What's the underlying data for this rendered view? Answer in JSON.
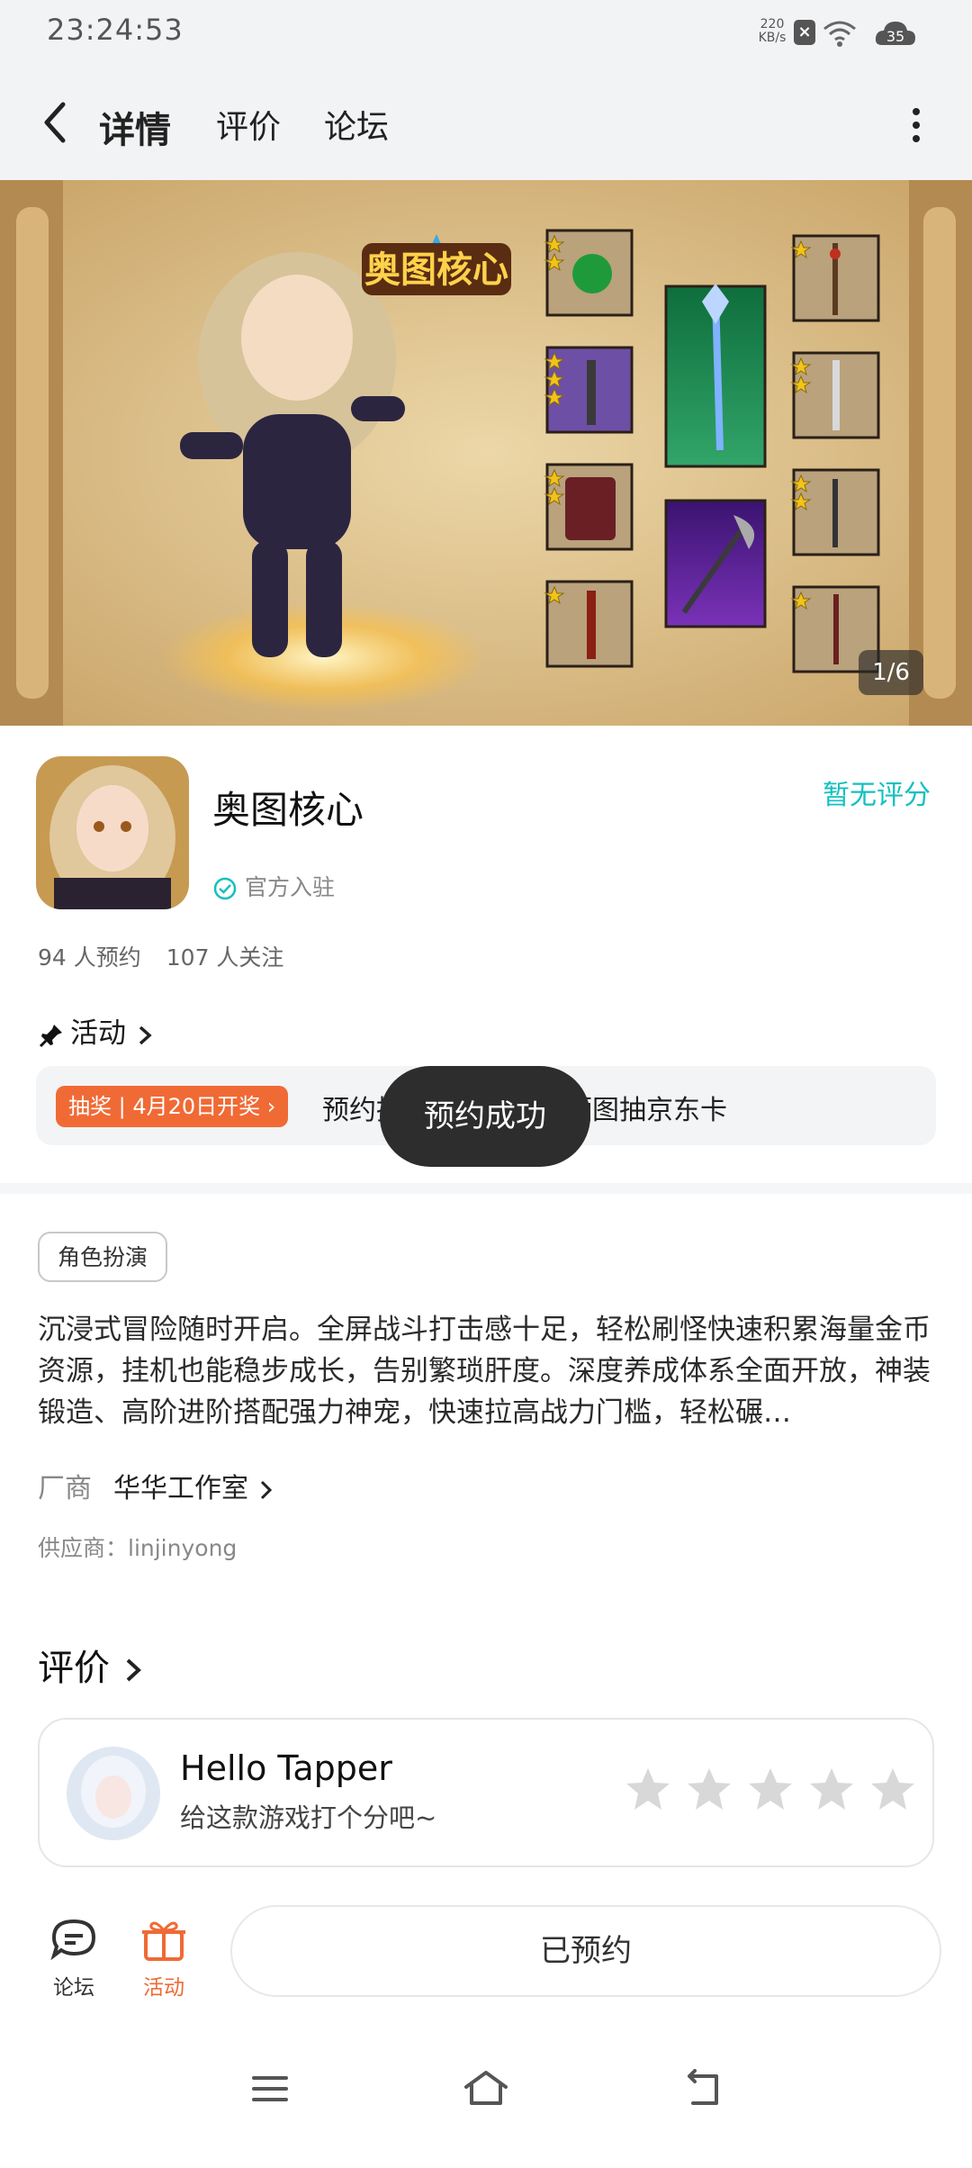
{
  "status_bar": {
    "time": "23:24:53",
    "speed_value": "220",
    "speed_unit": "KB/s",
    "battery": "35"
  },
  "nav": {
    "tabs": [
      "详情",
      "评价",
      "论坛"
    ]
  },
  "banner": {
    "title": "奥图核心",
    "counter": "1/6"
  },
  "app": {
    "name": "奥图核心",
    "badge": "官方入驻",
    "rating": "暂无评分",
    "reservations": "94 人预约",
    "followers": "107 人关注"
  },
  "activity": {
    "heading": "活动",
    "badge": "抽奖 | 4月20日开奖",
    "text": "预约抽奖活动】预约晒图抽京东卡"
  },
  "toast": "预约成功",
  "details": {
    "genre": "角色扮演",
    "description": "沉浸式冒险随时开启。全屏战斗打击感十足，轻松刷怪快速积累海量金币资源，挂机也能稳步成长，告别繁琐肝度。深度养成体系全面开放，神装锻造、高阶进阶搭配强力神宠，快速拉高战力门槛，轻松碾…",
    "vendor_label": "厂商",
    "vendor": "华华工作室",
    "supplier": "供应商：linjinyong"
  },
  "review": {
    "heading": "评价",
    "user": "Hello Tapper",
    "prompt": "给这款游戏打个分吧~",
    "stars": 0
  },
  "bottom": {
    "forum": "论坛",
    "activity": "活动",
    "reserved": "已预约"
  },
  "colors": {
    "accent": "#15c5ce",
    "orange": "#f06a35",
    "rating": "#15c0c0"
  }
}
